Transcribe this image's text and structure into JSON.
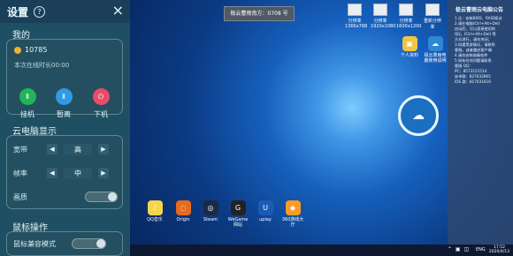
{
  "panel": {
    "title": "设置",
    "help": "?",
    "close": "×",
    "sections": {
      "mine": "我的",
      "display": "云电脑显示",
      "mouse": "鼠标操作"
    },
    "account": {
      "id": "10785",
      "online_time": "本次在线时长00:00"
    },
    "actions": [
      {
        "label": "挂机",
        "color": "#20b557",
        "icon": "pause-icon"
      },
      {
        "label": "暂离",
        "color": "#2f9ae5",
        "icon": "pause-icon"
      },
      {
        "label": "下机",
        "color": "#e74c6a",
        "icon": "power-icon"
      }
    ],
    "display": {
      "width_label": "宽带",
      "width_value": "高",
      "fps_label": "帧率",
      "fps_value": "中",
      "quality_label": "画质"
    },
    "mouse": {
      "compat_label": "鼠标兼容模式"
    }
  },
  "desktop": {
    "notice": "极云曹雨南方：0708 号",
    "resolution_items": [
      {
        "label": "分辨率 1366x768"
      },
      {
        "label": "分辨率 1920x1080"
      },
      {
        "label": "分辨率 1600x1200"
      },
      {
        "label": "重新分辨率"
      }
    ],
    "icons": [
      {
        "label": "个人资料",
        "color": "#f1c542",
        "icon": "folder-icon"
      },
      {
        "label": "极云曹雨电脑使用说明",
        "color": "#2f86d6",
        "icon": "cloud-icon"
      },
      {
        "label": "QQ音乐",
        "color": "#f6d54a",
        "icon": "music-icon"
      },
      {
        "label": "Origin",
        "color": "#e66b1f",
        "icon": "origin-icon"
      },
      {
        "label": "Steam",
        "color": "#1b2a46",
        "icon": "steam-icon"
      },
      {
        "label": "WeGame 网站",
        "color": "#222222",
        "icon": "wegame-icon"
      },
      {
        "label": "uplay",
        "color": "#1c5bb6",
        "icon": "uplay-icon"
      },
      {
        "label": "360游戏大厅",
        "color": "#ff9b22",
        "icon": "game-hall-icon"
      }
    ],
    "right_panel": {
      "title": "极云曹雨云电脑公告",
      "lines": [
        "1.注：安装BIOS、RAID驱动",
        "2.请在电脑(Ctrl+Alt+Del)",
        "启动后，可以直接使用的",
        "QQ，(Ctrl+Alt+Del) 等",
        "方式进行，请勿关闭；",
        "3.如遇黑屏情况，请联系",
        "客服，或者重启客户端",
        "4.请勿安装病毒软件",
        "5.如有任何问题请联系",
        "客服 QQ：",
        "PC：8573151514",
        "安卓群：827032665",
        "IOS 群：817031616"
      ]
    },
    "taskbar": {
      "lang": "ENG",
      "time": "17:52",
      "date": "2020/4/13"
    }
  }
}
